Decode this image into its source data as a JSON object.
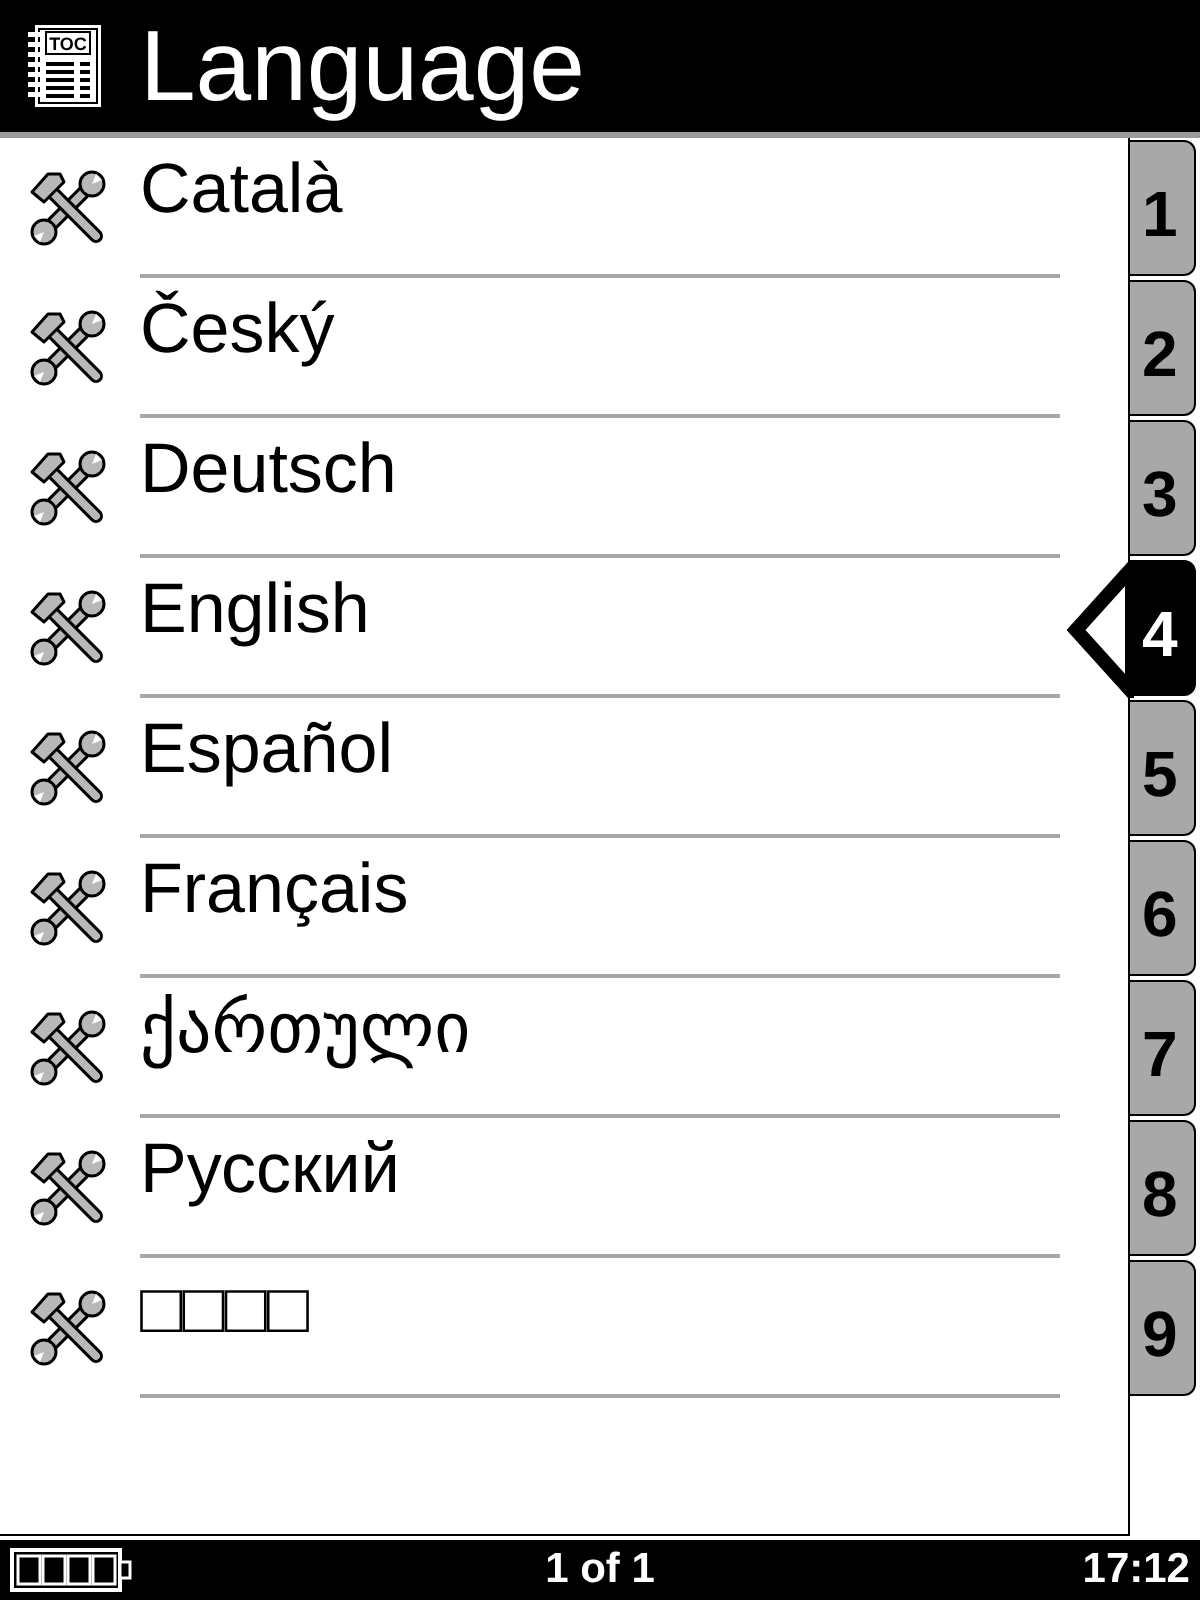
{
  "header": {
    "icon_text": "TOC",
    "title": "Language"
  },
  "languages": [
    {
      "label": "Català"
    },
    {
      "label": "Český"
    },
    {
      "label": "Deutsch"
    },
    {
      "label": "English"
    },
    {
      "label": "Español"
    },
    {
      "label": "Français"
    },
    {
      "label": "ქართული"
    },
    {
      "label": "Русский"
    },
    {
      "label": "□□□□"
    }
  ],
  "index_tabs": [
    {
      "label": "1",
      "selected": false
    },
    {
      "label": "2",
      "selected": false
    },
    {
      "label": "3",
      "selected": false
    },
    {
      "label": "4",
      "selected": true
    },
    {
      "label": "5",
      "selected": false
    },
    {
      "label": "6",
      "selected": false
    },
    {
      "label": "7",
      "selected": false
    },
    {
      "label": "8",
      "selected": false
    },
    {
      "label": "9",
      "selected": false
    }
  ],
  "status_bar": {
    "page": "1 of 1",
    "time": "17:12"
  }
}
